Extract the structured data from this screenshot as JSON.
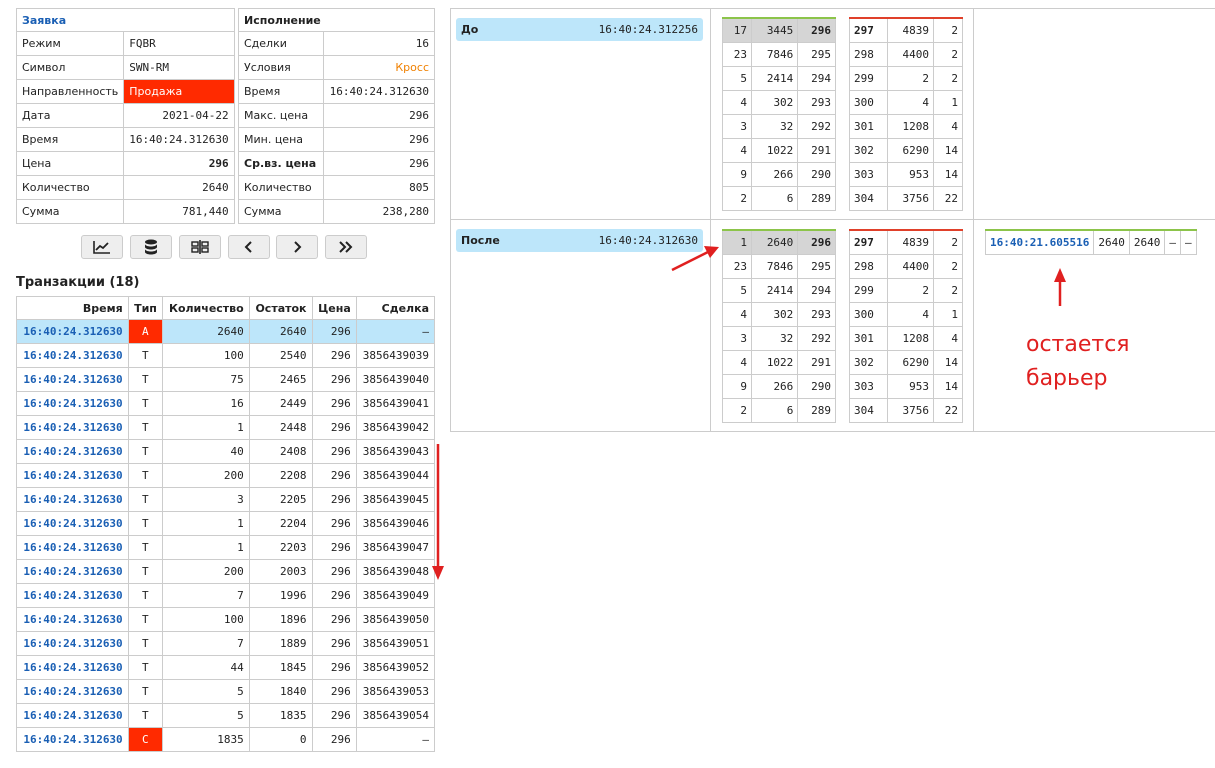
{
  "order": {
    "title": "Заявка",
    "rows": [
      {
        "label": "Режим",
        "value": "FQBR"
      },
      {
        "label": "Символ",
        "value": "SWN-RM"
      },
      {
        "label": "Направленность",
        "value": "Продажа"
      },
      {
        "label": "Дата",
        "value": "2021-04-22"
      },
      {
        "label": "Время",
        "value": "16:40:24.312630"
      },
      {
        "label": "Цена",
        "value": "296"
      },
      {
        "label": "Количество",
        "value": "2640"
      },
      {
        "label": "Сумма",
        "value": "781,440"
      }
    ]
  },
  "execution": {
    "title": "Исполнение",
    "rows": [
      {
        "label": "Сделки",
        "value": "16"
      },
      {
        "label": "Условия",
        "value": "Кросс"
      },
      {
        "label": "Время",
        "value": "16:40:24.312630"
      },
      {
        "label": "Макс. цена",
        "value": "296"
      },
      {
        "label": "Мин. цена",
        "value": "296"
      },
      {
        "label": "Ср.вз. цена",
        "value": "296"
      },
      {
        "label": "Количество",
        "value": "805"
      },
      {
        "label": "Сумма",
        "value": "238,280"
      }
    ]
  },
  "toolbar": [
    "chart-line-icon",
    "database-icon",
    "split-icon",
    "chevron-left-icon",
    "chevron-right-icon",
    "double-chevron-right-icon"
  ],
  "transactions": {
    "title": "Транзакции (18)",
    "columns": [
      "Время",
      "Тип",
      "Количество",
      "Остаток",
      "Цена",
      "Сделка"
    ],
    "rows": [
      [
        "16:40:24.312630",
        "A",
        "2640",
        "2640",
        "296",
        "–"
      ],
      [
        "16:40:24.312630",
        "T",
        "100",
        "2540",
        "296",
        "3856439039"
      ],
      [
        "16:40:24.312630",
        "T",
        "75",
        "2465",
        "296",
        "3856439040"
      ],
      [
        "16:40:24.312630",
        "T",
        "16",
        "2449",
        "296",
        "3856439041"
      ],
      [
        "16:40:24.312630",
        "T",
        "1",
        "2448",
        "296",
        "3856439042"
      ],
      [
        "16:40:24.312630",
        "T",
        "40",
        "2408",
        "296",
        "3856439043"
      ],
      [
        "16:40:24.312630",
        "T",
        "200",
        "2208",
        "296",
        "3856439044"
      ],
      [
        "16:40:24.312630",
        "T",
        "3",
        "2205",
        "296",
        "3856439045"
      ],
      [
        "16:40:24.312630",
        "T",
        "1",
        "2204",
        "296",
        "3856439046"
      ],
      [
        "16:40:24.312630",
        "T",
        "1",
        "2203",
        "296",
        "3856439047"
      ],
      [
        "16:40:24.312630",
        "T",
        "200",
        "2003",
        "296",
        "3856439048"
      ],
      [
        "16:40:24.312630",
        "T",
        "7",
        "1996",
        "296",
        "3856439049"
      ],
      [
        "16:40:24.312630",
        "T",
        "100",
        "1896",
        "296",
        "3856439050"
      ],
      [
        "16:40:24.312630",
        "T",
        "7",
        "1889",
        "296",
        "3856439051"
      ],
      [
        "16:40:24.312630",
        "T",
        "44",
        "1845",
        "296",
        "3856439052"
      ],
      [
        "16:40:24.312630",
        "T",
        "5",
        "1840",
        "296",
        "3856439053"
      ],
      [
        "16:40:24.312630",
        "T",
        "5",
        "1835",
        "296",
        "3856439054"
      ],
      [
        "16:40:24.312630",
        "C",
        "1835",
        "0",
        "296",
        "–"
      ]
    ]
  },
  "before": {
    "label": "До",
    "time": "16:40:24.312256",
    "bids": [
      [
        "17",
        "3445",
        "296"
      ],
      [
        "23",
        "7846",
        "295"
      ],
      [
        "5",
        "2414",
        "294"
      ],
      [
        "4",
        "302",
        "293"
      ],
      [
        "3",
        "32",
        "292"
      ],
      [
        "4",
        "1022",
        "291"
      ],
      [
        "9",
        "266",
        "290"
      ],
      [
        "2",
        "6",
        "289"
      ]
    ],
    "asks": [
      [
        "297",
        "4839",
        "2"
      ],
      [
        "298",
        "4400",
        "2"
      ],
      [
        "299",
        "2",
        "2"
      ],
      [
        "300",
        "4",
        "1"
      ],
      [
        "301",
        "1208",
        "4"
      ],
      [
        "302",
        "6290",
        "14"
      ],
      [
        "303",
        "953",
        "14"
      ],
      [
        "304",
        "3756",
        "22"
      ]
    ]
  },
  "after": {
    "label": "После",
    "time": "16:40:24.312630",
    "bids": [
      [
        "1",
        "2640",
        "296"
      ],
      [
        "23",
        "7846",
        "295"
      ],
      [
        "5",
        "2414",
        "294"
      ],
      [
        "4",
        "302",
        "293"
      ],
      [
        "3",
        "32",
        "292"
      ],
      [
        "4",
        "1022",
        "291"
      ],
      [
        "9",
        "266",
        "290"
      ],
      [
        "2",
        "6",
        "289"
      ]
    ],
    "asks": [
      [
        "297",
        "4839",
        "2"
      ],
      [
        "298",
        "4400",
        "2"
      ],
      [
        "299",
        "2",
        "2"
      ],
      [
        "300",
        "4",
        "1"
      ],
      [
        "301",
        "1208",
        "4"
      ],
      [
        "302",
        "6290",
        "14"
      ],
      [
        "303",
        "953",
        "14"
      ],
      [
        "304",
        "3756",
        "22"
      ]
    ],
    "remaining": [
      "16:40:21.605516",
      "2640",
      "2640",
      "–",
      "–"
    ]
  },
  "annotation": {
    "line1": "остается",
    "line2": "барьер"
  },
  "colors": {
    "accent_blue": "#1a5fb4",
    "highlight": "#bde6fa",
    "sell_red": "#ff2a00",
    "cross_orange": "#f08000",
    "annotation_red": "#e02020",
    "bid_border": "#8cc44a",
    "ask_border": "#e0402a"
  }
}
